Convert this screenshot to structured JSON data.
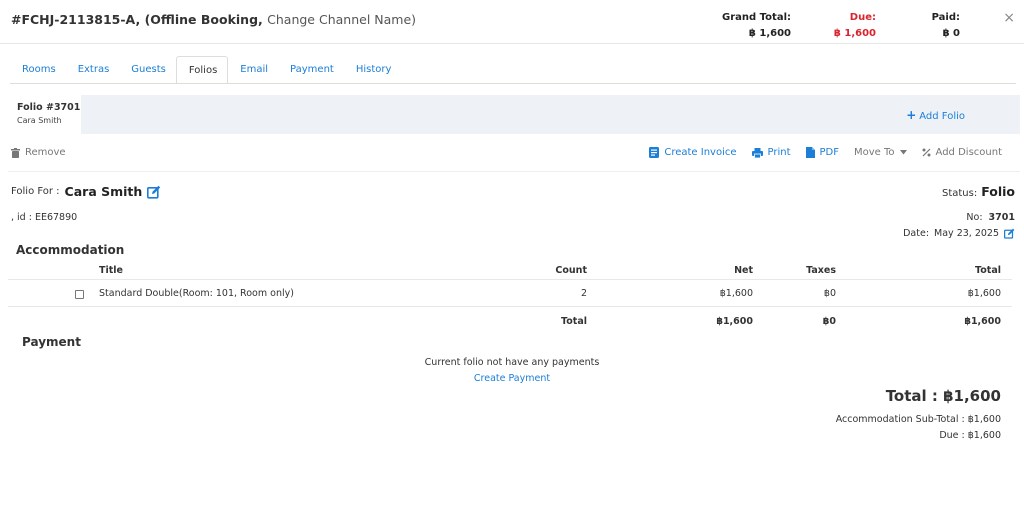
{
  "header": {
    "booking_id": "#FCHJ-2113815-A,",
    "booking_type": "(Offline Booking,",
    "change_channel": "Change Channel Name)",
    "grand_total_label": "Grand Total:",
    "grand_total_value": "฿ 1,600",
    "due_label": "Due:",
    "due_value": "฿ 1,600",
    "paid_label": "Paid:",
    "paid_value": "฿ 0",
    "close": "×"
  },
  "tabs": [
    {
      "label": "Rooms"
    },
    {
      "label": "Extras"
    },
    {
      "label": "Guests"
    },
    {
      "label": "Folios"
    },
    {
      "label": "Email"
    },
    {
      "label": "Payment"
    },
    {
      "label": "History"
    }
  ],
  "active_tab": "Folios",
  "folio_strip": {
    "folio_number": "Folio #3701",
    "guest_name": "Cara Smith",
    "add_folio": "Add Folio"
  },
  "actions": {
    "remove": "Remove",
    "create_invoice": "Create Invoice",
    "print": "Print",
    "pdf": "PDF",
    "move_to": "Move To",
    "add_discount": "Add Discount"
  },
  "folio_info": {
    "folio_for_label": "Folio For :",
    "folio_for_name": "Cara Smith",
    "status_label": "Status:",
    "status_value": "Folio",
    "guest_id": ", id : EE67890",
    "no_label": "No:",
    "no_value": "3701",
    "date_label": "Date:",
    "date_value": "May 23, 2025"
  },
  "accommodation": {
    "title": "Accommodation",
    "columns": {
      "title": "Title",
      "count": "Count",
      "net": "Net",
      "taxes": "Taxes",
      "total": "Total"
    },
    "rows": [
      {
        "title": "Standard Double(Room: 101, Room only)",
        "count": "2",
        "net": "฿1,600",
        "taxes": "฿0",
        "total": "฿1,600"
      }
    ],
    "totals": {
      "label": "Total",
      "net": "฿1,600",
      "taxes": "฿0",
      "total": "฿1,600"
    }
  },
  "payment": {
    "title": "Payment",
    "empty_message": "Current folio not have any payments",
    "create_payment": "Create Payment"
  },
  "summary": {
    "grand_total": "Total : ฿1,600",
    "subtotal": "Accommodation Sub-Total : ฿1,600",
    "due": "Due : ฿1,600"
  },
  "colors": {
    "link": "#1c7ed6",
    "due": "#d9232d",
    "strip": "#eef2f7"
  }
}
